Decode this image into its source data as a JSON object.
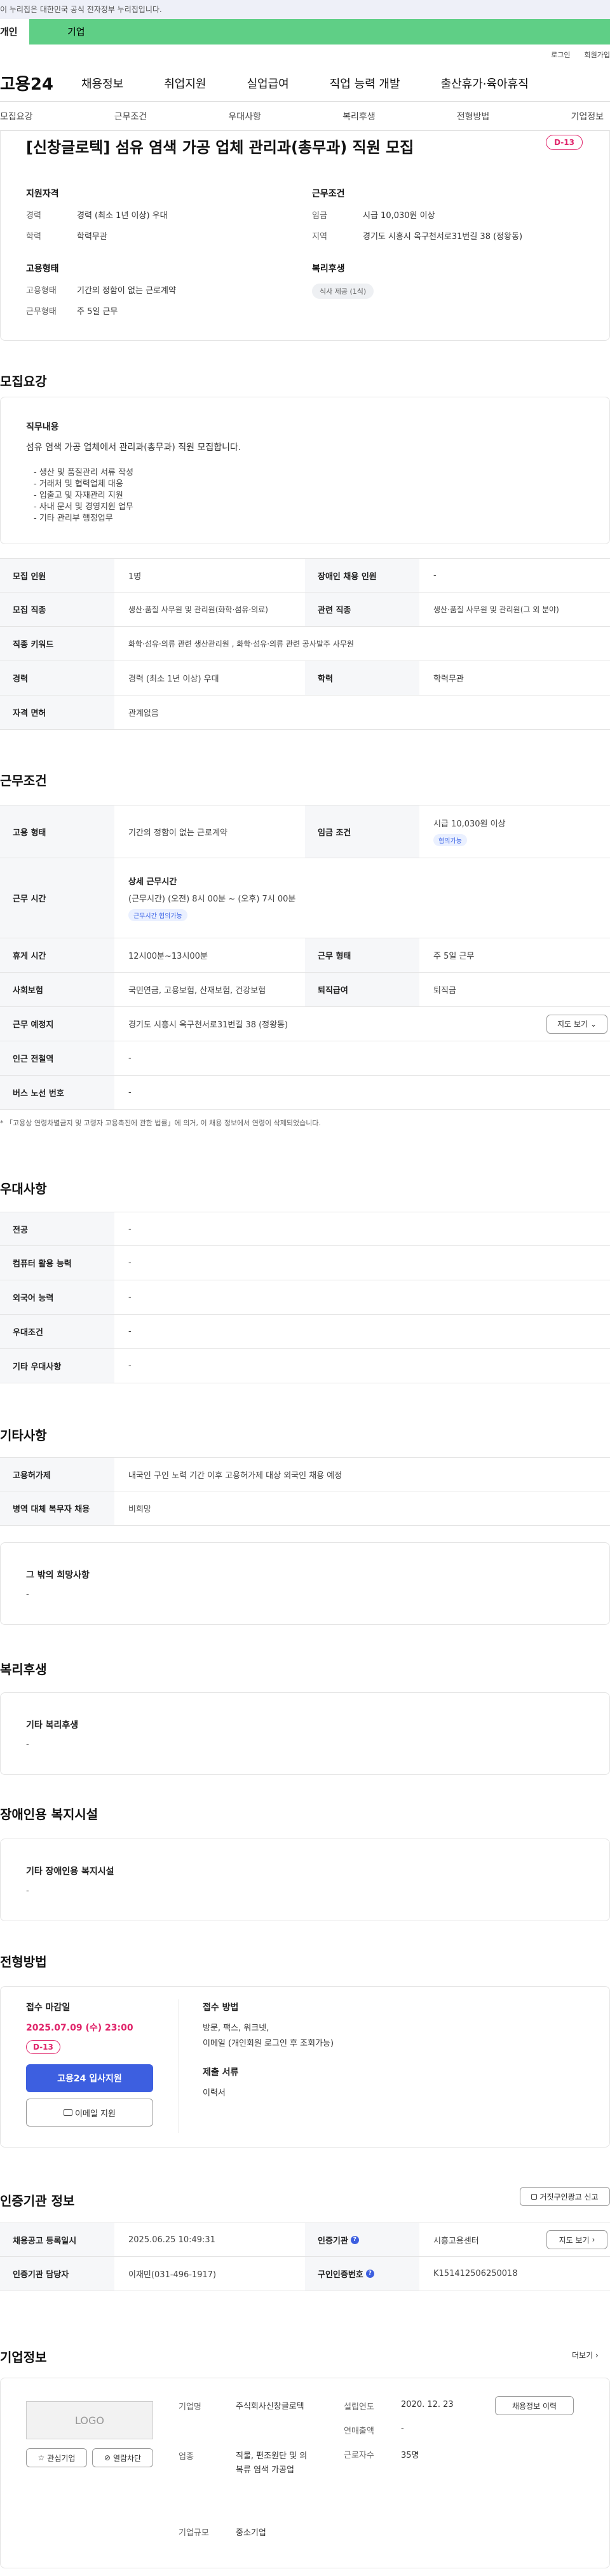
{
  "gov_bar": "이 누리집은 대한민국 공식 전자정부 누리집입니다.",
  "tabs": {
    "personal": "개인",
    "company": "기업"
  },
  "util": {
    "login": "로그인",
    "join": "회원가입"
  },
  "nav": {
    "logo": "고용24",
    "items": [
      "채용정보",
      "취업지원",
      "실업급여",
      "직업 능력 개발",
      "출산휴가·육아휴직"
    ]
  },
  "subnav": [
    "모집요강",
    "근무조건",
    "우대사항",
    "복리후생",
    "전형방법",
    "기업정보"
  ],
  "header": {
    "title": "[신창글로텍] 섬유 염색 가공 업체 관리과(총무과) 직원 모집",
    "dday": "D-13",
    "qual_title": "지원자격",
    "career_k": "경력",
    "career_v": "경력 (최소 1년 이상) 우대",
    "edu_k": "학력",
    "edu_v": "학력무관",
    "cond_title": "근무조건",
    "wage_k": "임금",
    "wage_v": "시급 10,030원 이상",
    "region_k": "지역",
    "region_v": "경기도 시흥시 옥구천서로31번길 38 (정왕동)",
    "emp_title": "고용형태",
    "emptype_k": "고용형태",
    "emptype_v": "기간의 정함이 없는 근로계약",
    "worktype_k": "근무형태",
    "worktype_v": "주 5일 근무",
    "welfare_title": "복리후생",
    "welfare_chip": "식사 제공 (1식)"
  },
  "recruit": {
    "section_title": "모집요강",
    "duty_title": "직무내용",
    "duty_intro": "섬유 염색 가공 업체에서 관리과(총무과) 직원 모집합니다.",
    "duty_list": [
      "- 생산 및 품질관리 서류 작성",
      "- 거래처 및 협력업체 대응",
      "- 입출고 및 자재관리 지원",
      "- 사내 문서 및 경영지원 업무",
      "- 기타 관리부 행정업무"
    ],
    "rows": [
      {
        "k1": "모집 인원",
        "v1": "1명",
        "k2": "장애인 채용 인원",
        "v2": "-"
      },
      {
        "k1": "모집 직종",
        "v1": "생산·품질 사무원 및 관리원(화학·섬유·의료)",
        "k2": "관련 직종",
        "v2": "생산·품질 사무원 및 관리원(그 외 분야)"
      },
      {
        "k1": "직종 키워드",
        "v1": "화학·섬유·의류 관련 생산관리원 , 화학·섬유·의류 관련 공사발주 사무원"
      },
      {
        "k1": "경력",
        "v1": "경력 (최소 1년 이상) 우대",
        "k2": "학력",
        "v2": "학력무관"
      },
      {
        "k1": "자격 면허",
        "v1": "관계없음"
      }
    ]
  },
  "work": {
    "section_title": "근무조건",
    "emptype_k": "고용 형태",
    "emptype_v": "기간의 정함이 없는 근로계약",
    "wage_k": "임금 조건",
    "wage_v": "시급 10,030원 이상",
    "wage_chip": "협의가능",
    "time_k": "근무 시간",
    "time_title": "상세 근무시간",
    "time_v": "(근무시간) (오전) 8시 00분 ~ (오후) 7시 00분",
    "time_chip": "근무시간 협의가능",
    "rest_k": "휴게 시간",
    "rest_v": "12시00분~13시00분",
    "form_k": "근무 형태",
    "form_v": "주 5일 근무",
    "ins_k": "사회보험",
    "ins_v": "국민연금, 고용보험, 산재보험, 건강보험",
    "sev_k": "퇴직급여",
    "sev_v": "퇴직금",
    "place_k": "근무 예정지",
    "place_v": "경기도 시흥시 옥구천서로31번길 38 (정왕동)",
    "map_btn": "지도 보기",
    "subway_k": "인근 전철역",
    "subway_v": "-",
    "bus_k": "버스 노선 번호",
    "bus_v": "-",
    "note": "* 「고용상 연령차별금지 및 고령자 고용촉진에 관한 법률」에 의거, 이 채용 정보에서 연령이 삭제되었습니다."
  },
  "pref": {
    "section_title": "우대사항",
    "rows": [
      {
        "k": "전공",
        "v": "-"
      },
      {
        "k": "컴퓨터 활용 능력",
        "v": "-"
      },
      {
        "k": "외국어 능력",
        "v": "-"
      },
      {
        "k": "우대조건",
        "v": "-"
      },
      {
        "k": "기타 우대사항",
        "v": "-"
      }
    ]
  },
  "etc": {
    "section_title": "기타사항",
    "rows": [
      {
        "k": "고용허가제",
        "v": "내국인 구인 노력 기간 이후 고용허가제 대상 외국인 채용 예정"
      },
      {
        "k": "병역 대체 복무자 채용",
        "v": "비희망"
      }
    ],
    "hope_title": "그 밖의 희망사항",
    "hope_v": "-"
  },
  "welfare": {
    "section_title": "복리후생",
    "box_title": "기타 복리후생",
    "box_v": "-"
  },
  "disability": {
    "section_title": "장애인용 복지시설",
    "box_title": "기타 장애인용 복지시설",
    "box_v": "-"
  },
  "process": {
    "section_title": "전형방법",
    "deadline_title": "접수 마감일",
    "deadline": "2025.07.09 (수) 23:00",
    "dday": "D-13",
    "apply_btn": "고용24 입사지원",
    "email_btn": "이메일 지원",
    "method_title": "접수 방법",
    "method_line1": "방문, 팩스, 워크넷,",
    "method_line2": "이메일 (개인회원 로그인 후 조회가능)",
    "docs_title": "제출 서류",
    "docs_v": "이력서"
  },
  "cert": {
    "section_title": "인증기관 정보",
    "report_btn": "거짓구인광고 신고",
    "row1": {
      "k1": "채용공고 등록일시",
      "v1": "2025.06.25 10:49:31",
      "k2": "인증기관",
      "v2": "시흥고용센터",
      "btn": "지도 보기"
    },
    "row2": {
      "k1": "인증기관 담당자",
      "v1": "이재민(031-496-1917)",
      "k2": "구인인증번호",
      "v2": "K151412506250018"
    }
  },
  "company": {
    "section_title": "기업정보",
    "more": "더보기",
    "logo": "LOGO",
    "fav_btn": "관심기업",
    "block_btn": "열람차단",
    "name_k": "기업명",
    "name_v": "주식회사신창글로텍",
    "biz_k": "업종",
    "biz_v": "직물, 편조원단 및 의복류 염색 가공업",
    "size_k": "기업규모",
    "size_v": "중소기업",
    "year_k": "설립연도",
    "year_v": "2020. 12. 23",
    "sales_k": "연매출액",
    "sales_v": "-",
    "emp_k": "근로자수",
    "emp_v": "35명",
    "jobs_btn": "채용정보 이력"
  },
  "colors": {
    "accent": "#3d5fe0",
    "dday": "#e0246a",
    "green_tab": "#5fcf86"
  }
}
